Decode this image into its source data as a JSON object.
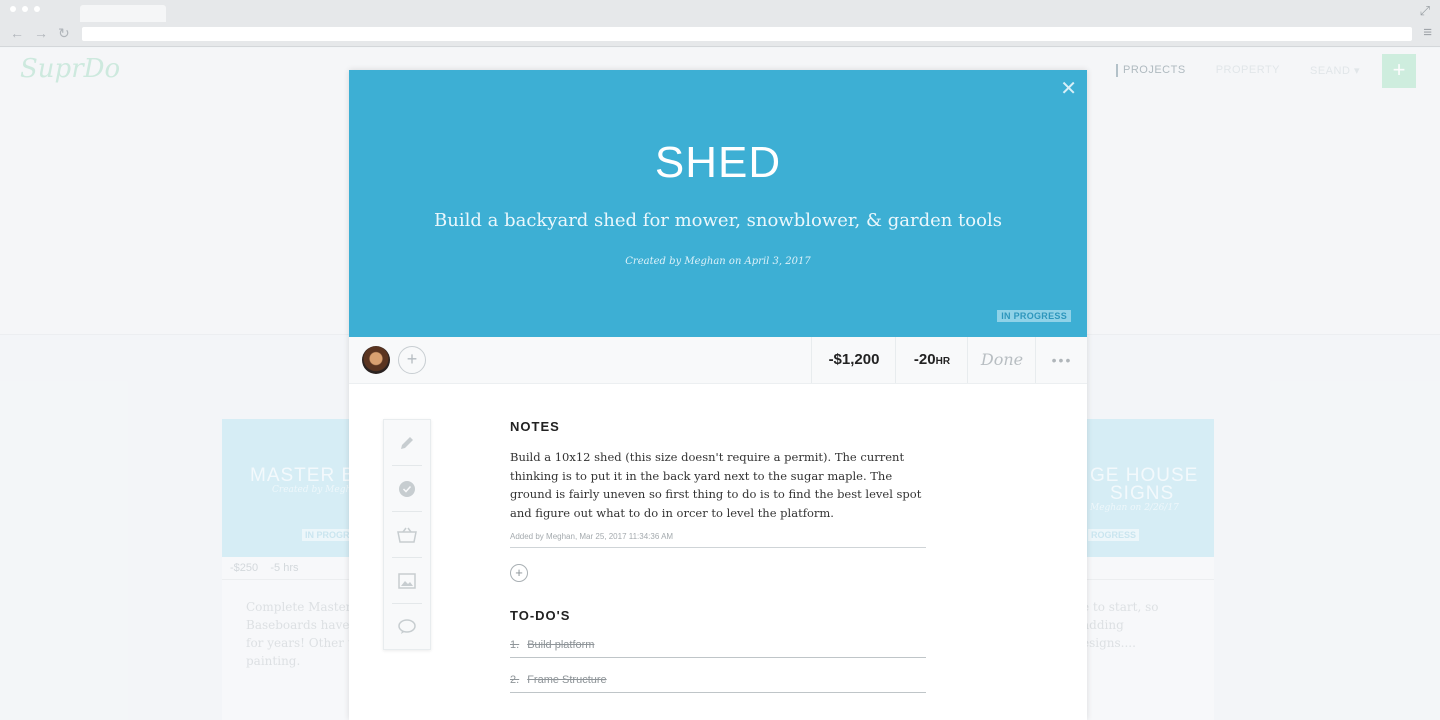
{
  "app": {
    "logo": "SuprDo",
    "nav": [
      "PROJECTS",
      "PROPERTY",
      "SEAND ▾"
    ],
    "add_label": "+"
  },
  "background_cards": [
    {
      "title": "MASTER B",
      "created": "Created by Megh",
      "badge": "IN PROGRESS",
      "cost": "-$250",
      "hours": "-5 hrs",
      "desc": [
        "Complete Master B",
        "Baseboards have b",
        "for years! Other tri",
        "painting."
      ]
    },
    {
      "title": "GE HOUSE",
      "title2": "SIGNS",
      "created": "Meghan on 2/26/17",
      "badge": "ROGRESS",
      "desc": [
        "e to start, so adding",
        "esigns...."
      ]
    }
  ],
  "modal": {
    "title": "SHED",
    "subtitle": "Build a backyard shed for mower, snowblower, & garden tools",
    "created": "Created by Meghan on April 3, 2017",
    "status": "IN PROGRESS",
    "cost": "-$1,200",
    "hours_value": "-20",
    "hours_unit": "HR",
    "done_label": "Done",
    "more_label": "•••",
    "add_member": "+",
    "notes_heading": "NOTES",
    "notes_body": "Build a 10x12 shed (this size doesn't require a permit). The current thinking is to put it in the back yard next to the sugar maple. The ground is fairly uneven so first thing to do is to find the best level spot and figure out what to do in orcer to level the platform.",
    "notes_added": "Added by Meghan, Mar 25, 2017 11:34:36 AM",
    "add_note": "+",
    "todos_heading": "TO-DO'S",
    "todos": [
      {
        "num": "1.",
        "text": "Build platform"
      },
      {
        "num": "2.",
        "text": "Frame Structure"
      }
    ],
    "tools": [
      "pencil-icon",
      "check-icon",
      "basket-icon",
      "image-icon",
      "comment-icon"
    ]
  },
  "colors": {
    "header": "#3dafd4",
    "accent": "#b8e8cf"
  }
}
